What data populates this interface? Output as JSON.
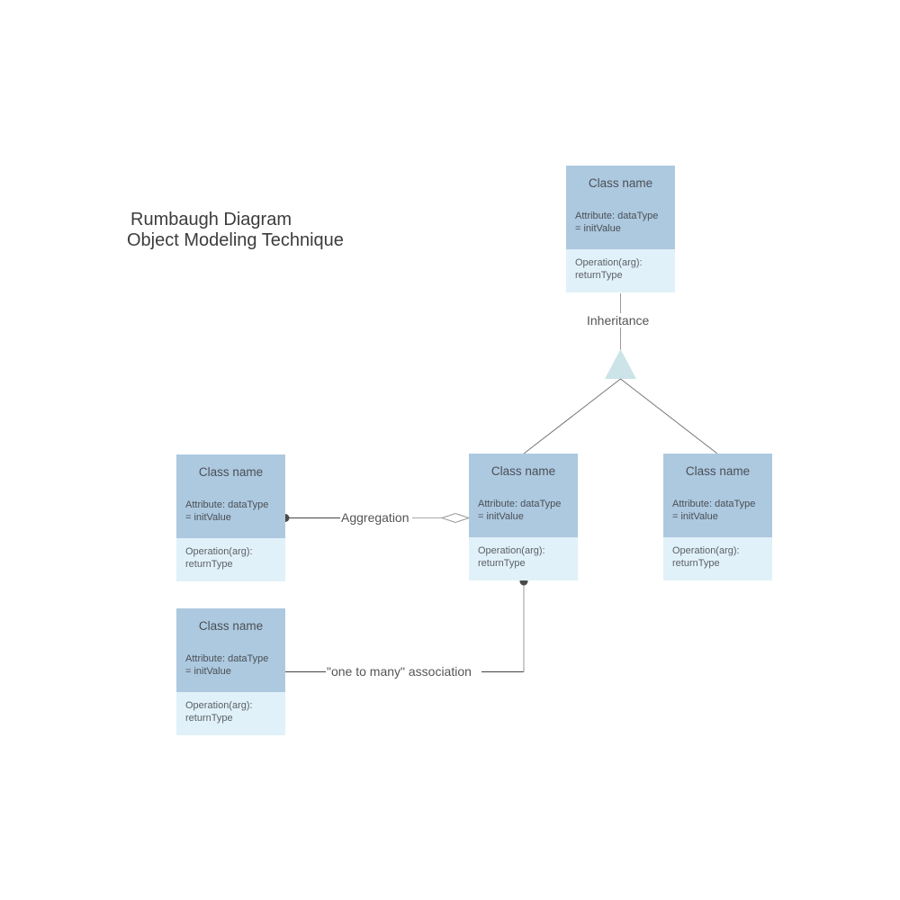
{
  "title": {
    "line1": "Rumbaugh Diagram",
    "line2": "Object Modeling Technique"
  },
  "colors": {
    "header_fill": "#adc9e0",
    "operations_fill": "#e1f1f9",
    "inheritance_triangle": "#cce4e8",
    "connector_dark": "#444444",
    "connector_light": "#aaaaaa"
  },
  "classes": [
    {
      "id": "parent",
      "name": "Class name",
      "attribute": "Attribute: dataType\n= initValue",
      "operation": "Operation(arg):\nreturnType"
    },
    {
      "id": "child-left",
      "name": "Class name",
      "attribute": "Attribute: dataType\n= initValue",
      "operation": "Operation(arg):\nreturnType"
    },
    {
      "id": "child-right",
      "name": "Class name",
      "attribute": "Attribute: dataType\n= initValue",
      "operation": "Operation(arg):\nreturnType"
    },
    {
      "id": "aggregate-part",
      "name": "Class name",
      "attribute": "Attribute: dataType\n= initValue",
      "operation": "Operation(arg):\nreturnType"
    },
    {
      "id": "association-end",
      "name": "Class name",
      "attribute": "Attribute: dataType\n= initValue",
      "operation": "Operation(arg):\nreturnType"
    }
  ],
  "relationships": {
    "inheritance": "Inheritance",
    "aggregation": "Aggregation",
    "association": "\"one to many\" association"
  }
}
